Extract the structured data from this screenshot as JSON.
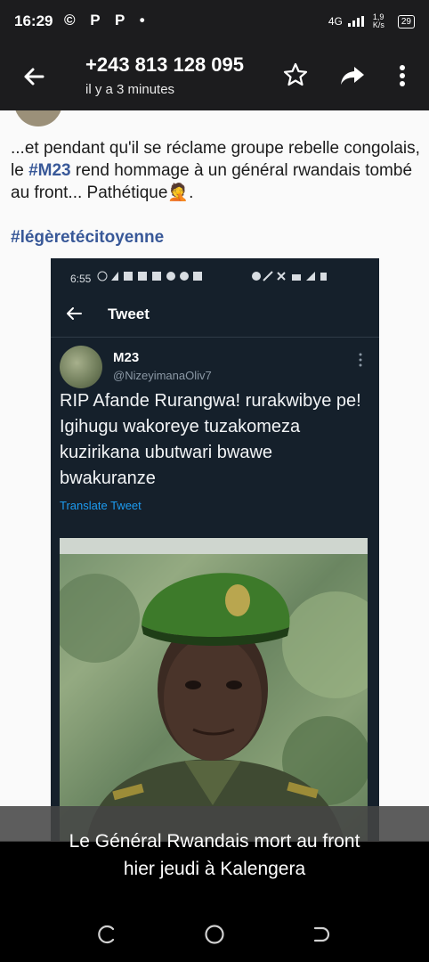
{
  "status_bar": {
    "time": "16:29",
    "left_icons": "© P P •",
    "network": "4G",
    "speed": "1,9 K/s",
    "battery": "29"
  },
  "app_bar": {
    "contact": "+243 813 128 095",
    "subtitle": "il y a 3 minutes"
  },
  "post": {
    "text_part1": "...et pendant qu'il se réclame groupe rebelle congolais, le ",
    "text_hashtag": "#M23",
    "text_part2": " rend hommage à un général rwandais tombé au front... Pathétique",
    "emoji": "🤦",
    "text_end": ".",
    "hashtag": "#légèretécitoyenne"
  },
  "screenshot": {
    "time": "6:55",
    "header_title": "Tweet",
    "account_name": "M23",
    "account_handle": "@NizeyimanaOliv7",
    "tweet_text": "RIP Afande Rurangwa! rurakwibye pe! Igihugu wakoreye tuzakomeza kuzirikana ubutwari bwawe bwakuranze",
    "translate": "Translate Tweet"
  },
  "caption": {
    "line1": "Le Général Rwandais mort au front",
    "line2": "hier  jeudi à  Kalengera"
  },
  "colors": {
    "accent_link": "#385898",
    "twitter_blue": "#1d9bf0",
    "dark_bg": "#15202b"
  }
}
